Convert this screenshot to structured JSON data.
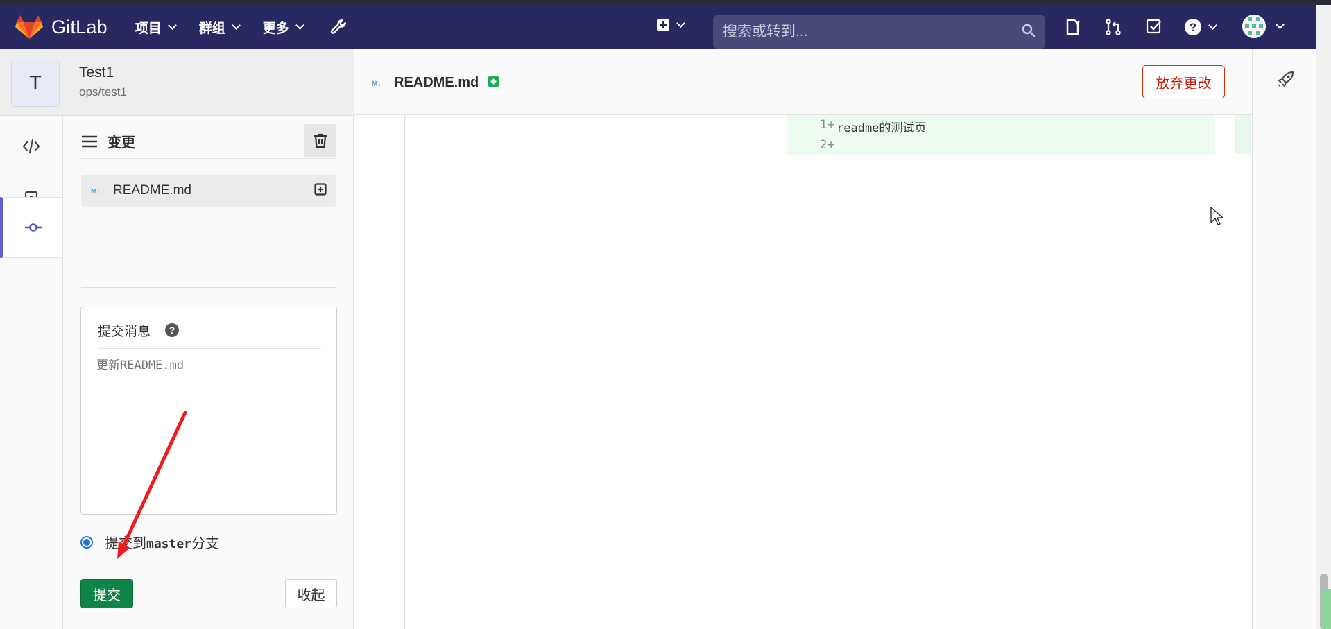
{
  "navbar": {
    "brand": "GitLab",
    "menu": [
      {
        "label": "项目"
      },
      {
        "label": "群组"
      },
      {
        "label": "更多"
      }
    ],
    "search_placeholder": "搜索或转到..."
  },
  "project": {
    "initial": "T",
    "name": "Test1",
    "path": "ops/test1"
  },
  "changes": {
    "title": "变更",
    "files": [
      {
        "icon": "markdown-icon",
        "name": "README.md",
        "status": "added"
      }
    ]
  },
  "commit": {
    "message_label": "提交消息",
    "message_placeholder": "更新README.md",
    "radio_prefix": "提交到",
    "branch": "master",
    "radio_suffix": "分支",
    "commit_label": "提交",
    "collapse_label": "收起"
  },
  "editor": {
    "tab_filename": "README.md",
    "discard_label": "放弃更改",
    "lines": [
      {
        "num": "1",
        "marker": "+",
        "text": "readme的测试页"
      },
      {
        "num": "2",
        "marker": "+",
        "text": ""
      }
    ]
  },
  "colors": {
    "navbar": "#292961",
    "commit_button": "#108548",
    "discard_border": "#dd2b0e",
    "diff_added": "#ecfdf0",
    "active_indicator": "#5b5fc7"
  }
}
